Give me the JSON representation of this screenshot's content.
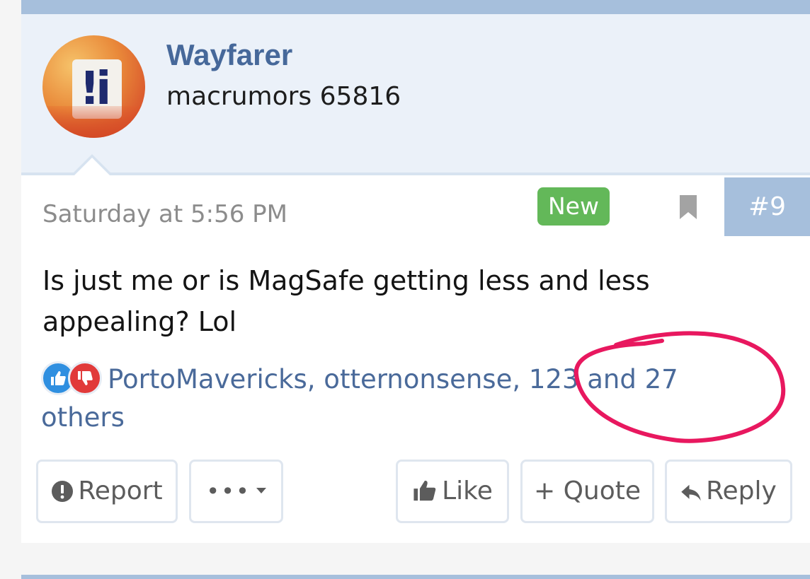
{
  "user": {
    "name": "Wayfarer",
    "title": "macrumors 65816"
  },
  "post": {
    "timestamp": "Saturday at 5:56 PM",
    "badge": "New",
    "number": "#9",
    "body": "Is just me or is MagSafe getting less and less appealing? Lol"
  },
  "reactions": {
    "users_line1": "PortoMavericks, otternonsense, 123 and 27",
    "users_line2": "others",
    "icons": [
      "thumbs-up-icon",
      "thumbs-down-icon"
    ]
  },
  "actions": {
    "report": "Report",
    "more": "•••",
    "like": "Like",
    "quote": "+ Quote",
    "reply": "Reply"
  },
  "colors": {
    "accent": "#a6bfdc",
    "link": "#4a6a9a",
    "new_badge": "#63b859",
    "annotation_circle": "#e8185f"
  }
}
